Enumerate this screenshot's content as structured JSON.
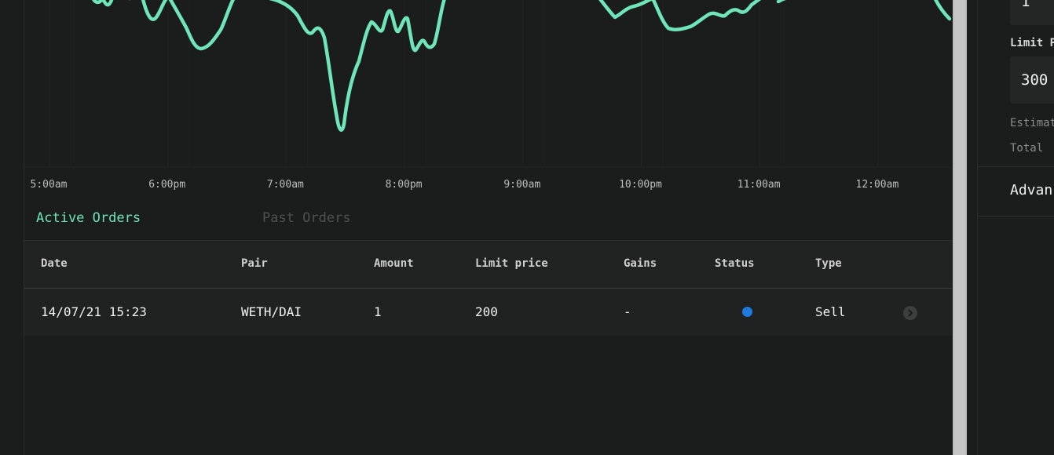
{
  "chart_data": {
    "type": "line",
    "x_ticks": [
      "5:00am",
      "6:00pm",
      "7:00am",
      "8:00pm",
      "9:00am",
      "10:00pm",
      "11:00am",
      "12:00am"
    ],
    "line_color": "#6ee6ba",
    "grid": true
  },
  "tabs": {
    "active": "Active Orders",
    "past": "Past Orders"
  },
  "table": {
    "headers": [
      "Date",
      "Pair",
      "Amount",
      "Limit price",
      "Gains",
      "Status",
      "Type"
    ],
    "rows": [
      {
        "date": "14/07/21 15:23",
        "pair": "WETH/DAI",
        "amount": "1",
        "limit_price": "200",
        "gains": "-",
        "status_color": "#1f7ae0",
        "type": "Sell"
      }
    ]
  },
  "order_form": {
    "quantity_value": "1",
    "limit_label": "Limit P",
    "limit_value": "300",
    "estimated_label": "Estimat",
    "total_label": "Total",
    "advanced_label": "Advan"
  },
  "icons": {
    "row_action": "chevron-right-icon",
    "status": "status-dot-icon"
  }
}
